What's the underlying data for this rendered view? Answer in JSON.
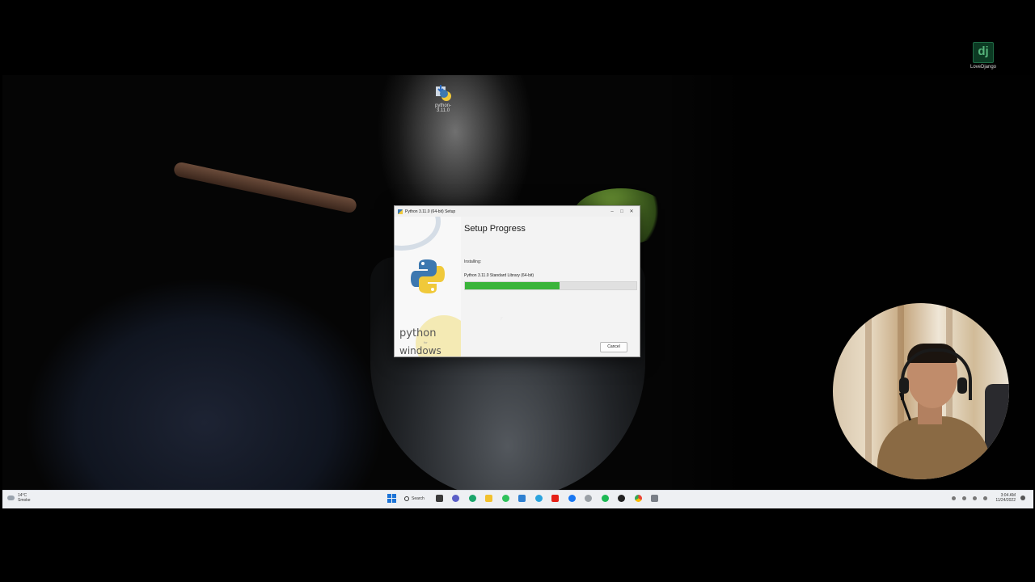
{
  "desktop": {
    "icons": [
      {
        "label": "python-3.11.0",
        "icon": "python-installer-icon"
      },
      {
        "label": "LoveDjango",
        "icon": "django-icon"
      }
    ]
  },
  "installer": {
    "window_title": "Python 3.11.0 (64-bit) Setup",
    "heading": "Setup Progress",
    "status_label": "Installing:",
    "component": "Python 3.11.0 Standard Library (64-bit)",
    "progress_fraction": 0.55,
    "cancel_label": "Cancel",
    "side_text": {
      "python": "python",
      "for": "for",
      "windows": "windows"
    },
    "colors": {
      "progress": "#3ab43a"
    }
  },
  "taskbar": {
    "weather": {
      "temp": "14°C",
      "condition": "Smoke"
    },
    "search_label": "Search",
    "apps": [
      "file-explorer",
      "chat",
      "edge",
      "explorer-folder",
      "whatsapp",
      "microsoft-store",
      "telegram",
      "youtube",
      "facebook",
      "spotify",
      "skype",
      "chrome",
      "word",
      "settings"
    ],
    "clock": {
      "time": "3:04 AM",
      "date": "11/24/2022"
    }
  }
}
